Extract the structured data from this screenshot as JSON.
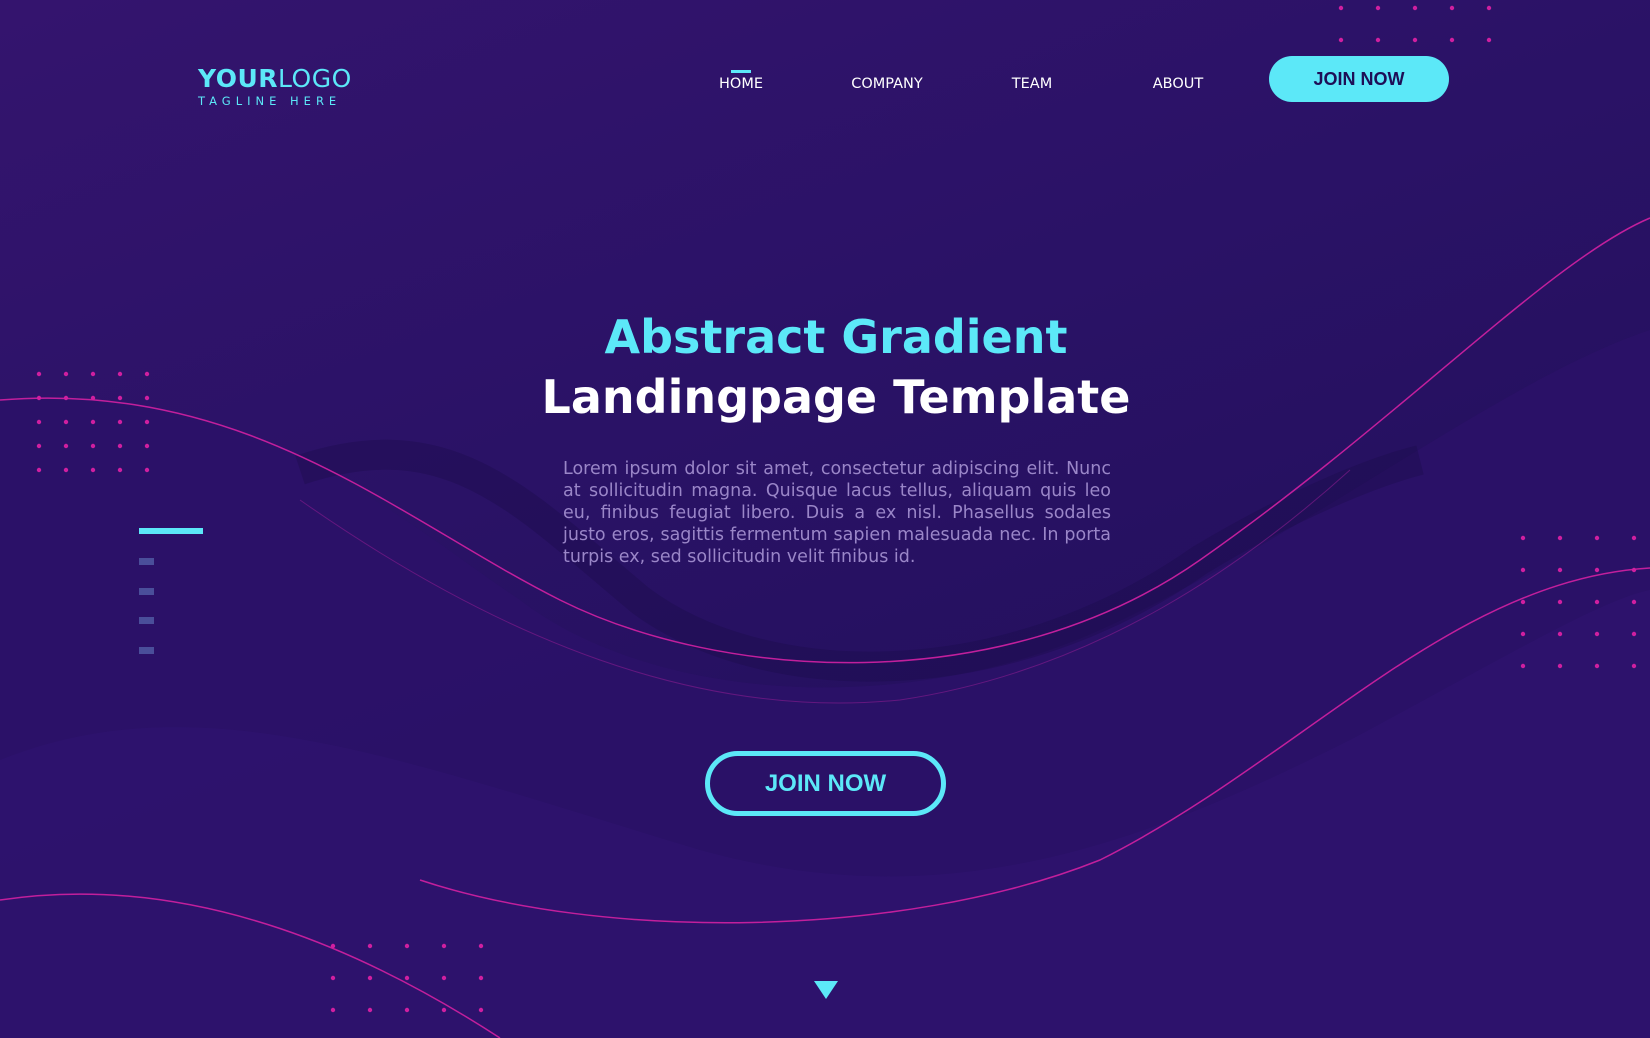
{
  "logo": {
    "bold": "YOUR",
    "light": "LOGO",
    "tagline": "TAGLINE HERE"
  },
  "nav": {
    "items": [
      {
        "label": "HOME",
        "active": true
      },
      {
        "label": "COMPANY"
      },
      {
        "label": "TEAM"
      },
      {
        "label": "ABOUT"
      }
    ],
    "cta": "JOIN NOW"
  },
  "hero": {
    "title_line1": "Abstract Gradient",
    "title_line2": "Landingpage Template",
    "body": "Lorem ipsum dolor sit amet, consectetur adipiscing elit. Nunc at sollicitudin magna. Quisque lacus tellus, aliquam quis leo eu, finibus feugiat libero. Duis a ex nisl. Phasellus sodales justo eros, sagittis fermentum sapien malesuada nec. In porta turpis ex, sed sollicitudin velit finibus id.",
    "cta": "JOIN NOW"
  },
  "colors": {
    "accent": "#5ce8f8",
    "magenta": "#d01fa0",
    "bg": "#2a1266"
  },
  "icons": {
    "scroll": "triangle-down-icon"
  }
}
